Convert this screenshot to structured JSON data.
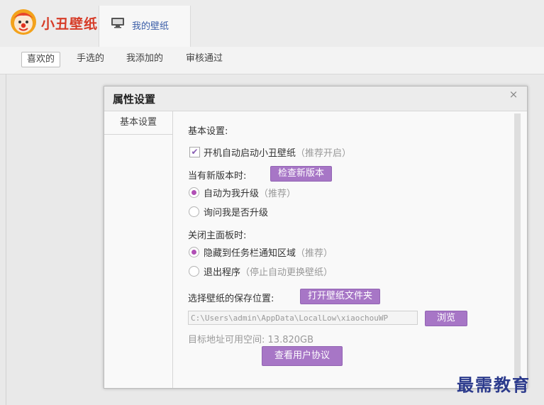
{
  "app": {
    "brand": "小丑壁纸",
    "my_wallpaper_tab": "我的壁纸"
  },
  "subtabs": [
    "喜欢的",
    "手选的",
    "我添加的",
    "审核通过"
  ],
  "dialog": {
    "title": "属性设置",
    "close_icon": "×",
    "sidebar": [
      "基本设置"
    ],
    "basic_heading": "基本设置:",
    "autostart": {
      "checked": true,
      "label": "开机自动启动小丑壁纸",
      "hint": "（推荐开启）"
    },
    "new_version": {
      "label": "当有新版本时:",
      "check_button": "检查新版本",
      "options": [
        {
          "label": "自动为我升级",
          "hint": "（推荐）",
          "selected": true
        },
        {
          "label": "询问我是否升级",
          "hint": "",
          "selected": false
        }
      ]
    },
    "close_panel": {
      "label": "关闭主面板时:",
      "options": [
        {
          "label": "隐藏到任务栏通知区域",
          "hint": "（推荐）",
          "selected": true
        },
        {
          "label": "退出程序",
          "hint": "（停止自动更换壁纸）",
          "selected": false
        }
      ]
    },
    "save_location": {
      "label": "选择壁纸的保存位置:",
      "open_button": "打开壁纸文件夹",
      "path": "C:\\Users\\admin\\AppData\\LocalLow\\xiaochouWP",
      "browse_button": "浏览",
      "free_space_label": "目标地址可用空间:",
      "free_space_value": "13.820GB"
    },
    "agreement_button": "查看用户协议"
  },
  "watermark": "最需教育",
  "colors": {
    "accent": "#a776c6",
    "brand": "#d63b27",
    "radio_dot": "#b04fb5"
  }
}
